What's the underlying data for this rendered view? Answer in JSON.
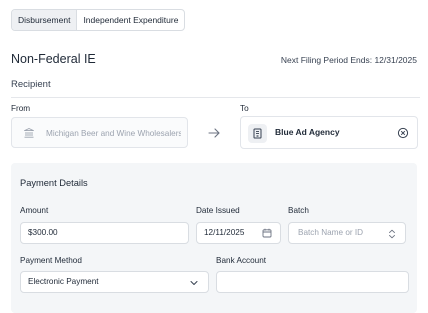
{
  "tabs": [
    {
      "label": "Disbursement",
      "active": true
    },
    {
      "label": "Independent Expenditure",
      "active": false
    }
  ],
  "page_title": "Non-Federal IE",
  "filing_period": "Next Filing Period Ends: 12/31/2025",
  "recipient": {
    "section_title": "Recipient",
    "from_label": "From",
    "from_value": "Michigan Beer and Wine Wholesalers Association",
    "from_icon": "bank-icon",
    "arrow_icon": "arrow-right-icon",
    "to_label": "To",
    "to_value": "Blue Ad Agency",
    "to_icon": "building-icon",
    "clear_icon": "clear-circle-icon"
  },
  "payment": {
    "title": "Payment Details",
    "amount_label": "Amount",
    "amount_value": "$300.00",
    "date_label": "Date Issued",
    "date_value": "12/11/2025",
    "batch_label": "Batch",
    "batch_placeholder": "Batch Name or ID",
    "method_label": "Payment Method",
    "method_value": "Electronic Payment",
    "bank_label": "Bank Account",
    "bank_value": ""
  },
  "colors": {
    "border": "#d9dde2",
    "panel_bg": "#f4f6f8",
    "muted_text": "#9ca3af",
    "text": "#1f2937"
  }
}
